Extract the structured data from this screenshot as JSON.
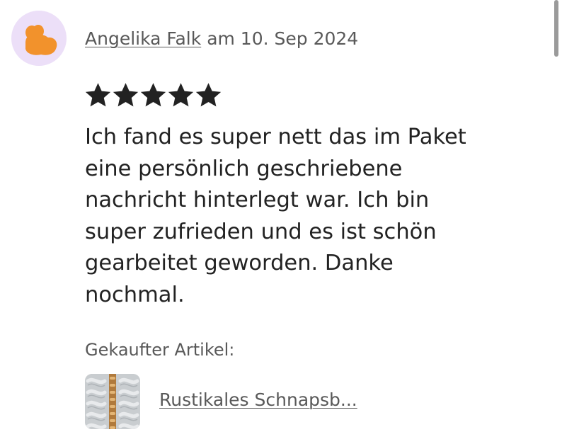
{
  "review": {
    "reviewer_name": "Angelika Falk",
    "date_text": "am 10. Sep 2024",
    "rating": 5,
    "rating_max": 5,
    "text": "Ich fand es super nett das im Paket\neine persönlich geschriebene\nnachricht hinterlegt war. Ich bin\nsuper zufrieden und es ist schön\ngearbeitet geworden. Danke\nnochmal."
  },
  "purchase": {
    "label": "Gekaufter Artikel:",
    "product_name": "Rustikales Schnapsb..."
  },
  "icons": {
    "avatar": "hand-avatar-icon",
    "star": "star-icon",
    "thumbnail": "product-thumbnail"
  },
  "colors": {
    "avatar_bg": "#ecdff8",
    "avatar_icon": "#f2922c",
    "star": "#222222",
    "muted_text": "#595959",
    "body_text": "#222222"
  }
}
